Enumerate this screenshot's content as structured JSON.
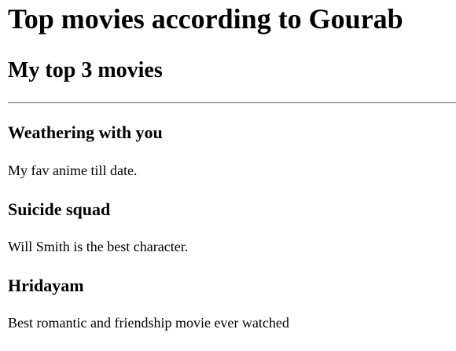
{
  "page": {
    "title": "Top movies according to Gourab",
    "section_heading": "My top 3 movies"
  },
  "movies": [
    {
      "title": "Weathering with you",
      "description": "My fav anime till date."
    },
    {
      "title": "Suicide squad",
      "description": "Will Smith is the best character."
    },
    {
      "title": "Hridayam",
      "description": "Best romantic and friendship movie ever watched"
    }
  ]
}
